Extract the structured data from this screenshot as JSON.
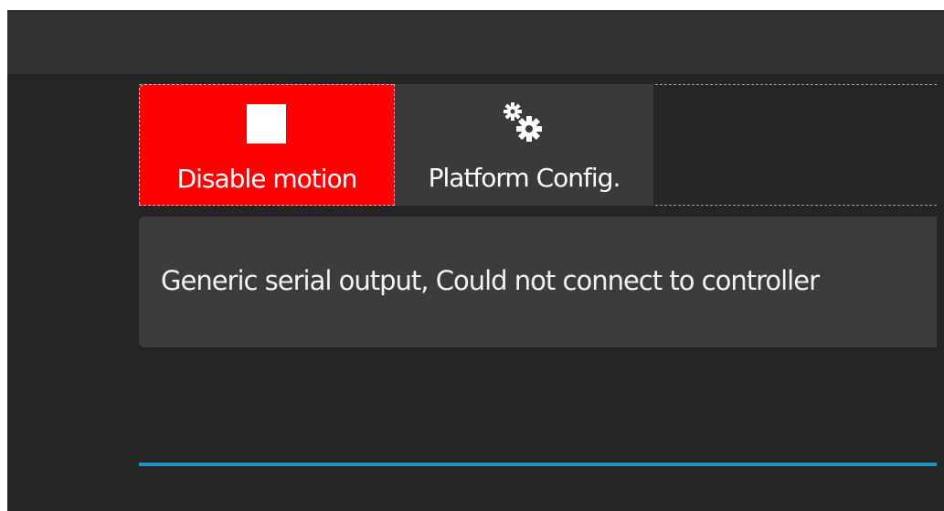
{
  "toolbar": {
    "disable_motion": {
      "label": "Disable motion",
      "icon": "stop-square-icon"
    },
    "platform_config": {
      "label": "Platform Config.",
      "icon": "gears-icon"
    }
  },
  "status": {
    "message": "Generic serial output, Could not connect to controller"
  },
  "colors": {
    "background": "#252525",
    "titlebar": "#313131",
    "disable_button": "#ff0000",
    "platform_button": "#3a3a3a",
    "status_panel": "#3c3c3c",
    "accent_line": "#1f92c9"
  }
}
